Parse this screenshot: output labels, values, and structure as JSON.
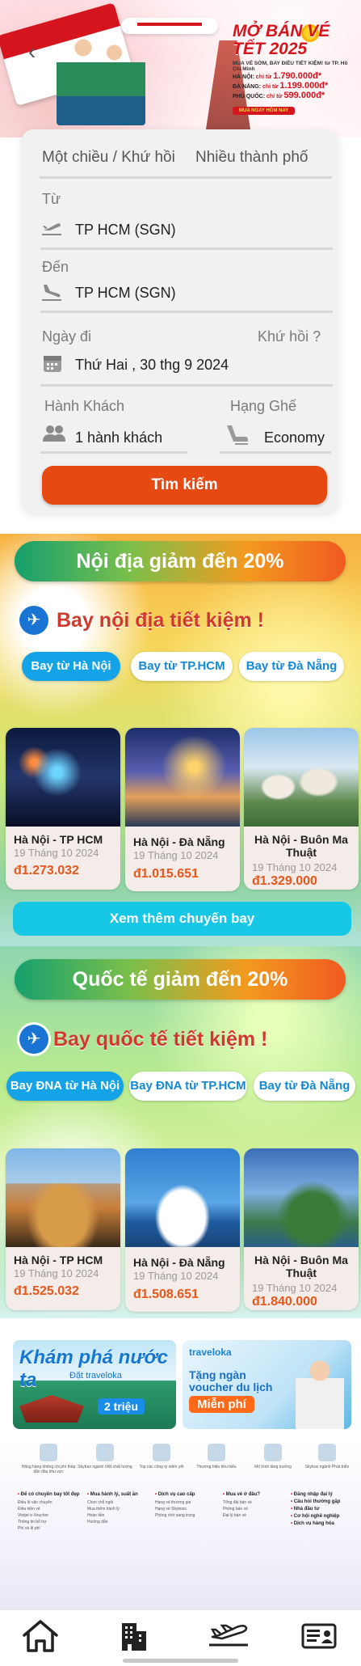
{
  "hero": {
    "back_icon": "chevron-left-icon",
    "promo_title": "MỞ BÁN VÉ TẾT 2025",
    "promo_subtitle": "MUA VÉ SỚM, BAY ĐIỀU TIẾT KIỆM! từ TP. Hồ Chí Minh",
    "routes": [
      {
        "city": "HÀ NỘI:",
        "prefix": "chỉ từ",
        "price": "1.790.000đ*"
      },
      {
        "city": "ĐÀ NẴNG:",
        "prefix": "chỉ từ",
        "price": "1.199.000đ*"
      },
      {
        "city": "PHÚ QUỐC:",
        "prefix": "chỉ từ",
        "price": "599.000đ*"
      }
    ],
    "cta": "MUA NGAY HÔM NAY"
  },
  "search": {
    "tabs": [
      {
        "label": "Một chiều / Khứ hồi"
      },
      {
        "label": "Nhiều thành phố"
      }
    ],
    "from_label": "Từ",
    "from_value": "TP HCM (SGN)",
    "to_label": "Đến",
    "to_value": "TP HCM (SGN)",
    "date_label": "Ngày đi",
    "return_label": "Khứ hồi ?",
    "date_value": "Thứ Hai , 30 thg 9 2024",
    "passenger_label": "Hành Khách",
    "passenger_value": "1 hành khách",
    "class_label": "Hạng Ghế",
    "class_value": "Economy",
    "search_button": "Tìm kiếm"
  },
  "domestic": {
    "banner": "Nội địa giảm đến 20%",
    "title": "Bay nội địa tiết kiệm !",
    "filters": [
      "Bay từ Hà Nội",
      "Bay từ TP.HCM",
      "Bay từ Đà Nẵng"
    ],
    "active_filter": 0,
    "cards": [
      {
        "route": "Hà Nội - TP HCM",
        "date": "19 Tháng 10 2024",
        "price": "đ1.273.032"
      },
      {
        "route": "Hà Nội - Đà Nẵng",
        "date": "19 Tháng 10 2024",
        "price": "đ1.015.651"
      },
      {
        "route": "Hà Nội - Buôn Ma Thuật",
        "date": "19 Tháng 10 2024",
        "price": "đ1.329.000"
      }
    ],
    "more_button": "Xem thêm chuyến bay"
  },
  "international": {
    "banner": "Quốc tế giảm đến 20%",
    "title": "Bay quốc tế tiết kiệm !",
    "filters": [
      "Bay ĐNA từ Hà Nội",
      "Bay ĐNA từ TP.HCM",
      "Bay từ Đà Nẵng"
    ],
    "active_filter": 0,
    "cards": [
      {
        "route": "Hà Nội - TP HCM",
        "date": "19 Tháng 10 2024",
        "price": "đ1.525.032"
      },
      {
        "route": "Hà Nội - Đà Nẵng",
        "date": "19 Tháng 10 2024",
        "price": "đ1.508.651"
      },
      {
        "route": "Hà Nội - Buôn Ma Thuật",
        "date": "19 Tháng 10 2024",
        "price": "đ1.840.000"
      }
    ]
  },
  "ads": {
    "ad1_title": "Khám phá nước ta",
    "ad1_sub": "Đặt traveloka",
    "ad1_amount": "2 triệu",
    "ad2_logo": "traveloka",
    "ad2_title": "Tặng ngàn voucher du lịch",
    "ad2_free": "Miễn phí"
  },
  "footer": {
    "awards": [
      "Hãng hàng không chi phí thấp dẫn đầu khu vực",
      "Skytrax ngành Việt chất lượng",
      "Top các công ty niêm yết",
      "Thương hiệu tiêu biểu",
      "Mô hình tăng trưởng",
      "Skytrax ngành Phát triển"
    ],
    "columns": [
      {
        "heading": "Để có chuyến bay tốt đẹp",
        "items": [
          "Điều lệ vận chuyển",
          "Điều kiện vé",
          "Vietjet e-Voucher",
          "Thông tin bổ trợ",
          "Phí và lệ phí"
        ]
      },
      {
        "heading": "Mua hành lý, suất ăn",
        "items": [
          "Chọn chỗ ngồi",
          "Mua thêm hành lý",
          "Hoàn tiền",
          "Hướng dẫn"
        ]
      },
      {
        "heading": "Dịch vụ cao cấp",
        "items": [
          "Hạng vé thương gia",
          "Hạng vé Skyboss",
          "Phòng chờ sang trọng"
        ]
      },
      {
        "heading": "Mua vé ở đâu?",
        "items": [
          "Tổng đài bán vé",
          "Phòng bán vé",
          "Đại lý bán vé"
        ]
      },
      {
        "heading": "Đăng nhập đại lý",
        "items": [
          "Câu hỏi thường gặp",
          "Nhà đầu tư",
          "Cơ hội nghề nghiệp",
          "Dịch vụ hàng hóa"
        ]
      }
    ]
  },
  "nav": {
    "items": [
      {
        "name": "home-icon"
      },
      {
        "name": "building-icon"
      },
      {
        "name": "airplane-icon"
      },
      {
        "name": "id-card-icon"
      }
    ]
  }
}
